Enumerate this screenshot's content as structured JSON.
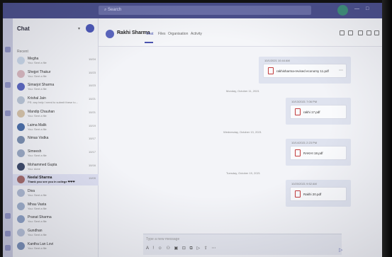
{
  "titlebar": {
    "search_label": "Search",
    "minimize": "—",
    "maximize": "□"
  },
  "chatlist": {
    "title": "Chat",
    "section": "Recent",
    "items": [
      {
        "name": "Megha",
        "preview": "You: Sent a file",
        "time": "10/24",
        "color": "#c9d7e8"
      },
      {
        "name": "Shejpri Thakur",
        "preview": "You: Sent a file",
        "time": "10/23",
        "color": "#d8b8c0"
      },
      {
        "name": "Simarjot Sharma",
        "preview": "You: Sent a file",
        "time": "10/23",
        "color": "#5b67c0"
      },
      {
        "name": "Krishal Jain",
        "preview": "PS: any help I need to submit these to...",
        "time": "10/21",
        "color": "#b9c5d6"
      },
      {
        "name": "Mandip Chauhan",
        "preview": "You: Sent a file",
        "time": "10/21",
        "color": "#d4c2a8"
      },
      {
        "name": "Laima Malik",
        "preview": "You: Sent a file",
        "time": "10/19",
        "color": "#4a6ea8"
      },
      {
        "name": "Nimas Vodka",
        "preview": "",
        "time": "10/17",
        "color": "#7b8fb0"
      },
      {
        "name": "Simeesh",
        "preview": "You: Sent a file",
        "time": "10/17",
        "color": "#9aa9c4"
      },
      {
        "name": "Mohammed Gupta",
        "preview": "You: done",
        "time": "10/16",
        "color": "#3d4a6a"
      },
      {
        "name": "Neelal Sharma",
        "preview": "Thank you see you in college ❤❤❤",
        "time": "10/09",
        "color": "#a36b6b"
      },
      {
        "name": "Diva",
        "preview": "You: Sent a file",
        "time": "",
        "color": "#aebad2"
      },
      {
        "name": "Mhau Vasta",
        "preview": "You: Sent a file",
        "time": "",
        "color": "#9fb0cc"
      },
      {
        "name": "Pranat Sharma",
        "preview": "You: Sent a file",
        "time": "",
        "color": "#8ea2c6"
      },
      {
        "name": "Gundhan",
        "preview": "You: Sent a file",
        "time": "",
        "color": "#b6c1d8"
      },
      {
        "name": "Kantha Lan Lovi",
        "preview": "You: Sent a file",
        "time": "",
        "color": "#7a90b8"
      }
    ]
  },
  "conversation": {
    "name": "Rakhi Sharma",
    "tabs": [
      "Chat",
      "Files",
      "Organisation",
      "Activity"
    ],
    "selected_tab": "Chat",
    "messages": [
      {
        "meta": "10/1/2021 10:44 AM",
        "file": "rakhisharma-revised economy 11.pdf"
      },
      {
        "meta": "10/13/2021 7:06 PM",
        "file": "rakhi 17.pdf"
      },
      {
        "meta": "10/14/2021 2:23 PM",
        "file": "RAKHI 18.pdf"
      },
      {
        "meta": "10/20/2021 9:52 AM",
        "file": "Rakhi 20.pdf"
      }
    ],
    "dividers": [
      "Monday, October 11, 2021",
      "Wednesday, October 13, 2021",
      "Tuesday, October 19, 2021"
    ]
  },
  "compose": {
    "placeholder": "Type a new message",
    "tools": "A ! ☺ ⚇ ▣ ⊡ ⧉ ▷ ⇪ ⋯",
    "send": "▷"
  },
  "colors": {
    "accent": "#4a55b0",
    "titlebar": "#4a4f8c"
  }
}
